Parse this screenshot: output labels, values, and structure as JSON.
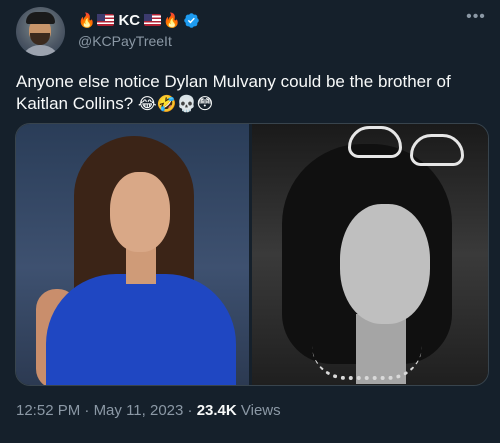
{
  "author": {
    "display_name": "KC",
    "handle": "@KCPayTreeIt",
    "verified": true,
    "name_decorations": [
      "🔥",
      "us-flag",
      "us-flag",
      "🔥"
    ]
  },
  "menu": {
    "more_icon": "more-horizontal-icon"
  },
  "tweet": {
    "text": "Anyone else notice Dylan Mulvany could be the brother of Kaitlan Collins?",
    "emojis": "😂🤣💀😳"
  },
  "media": {
    "count": 2
  },
  "meta": {
    "time": "12:52 PM",
    "separator": "·",
    "date": "May 11, 2023",
    "views_count": "23.4K",
    "views_label": "Views"
  },
  "colors": {
    "background": "#15202b",
    "text": "#f7f9f9",
    "secondary_text": "#8b98a5",
    "verified": "#1d9bf0"
  }
}
